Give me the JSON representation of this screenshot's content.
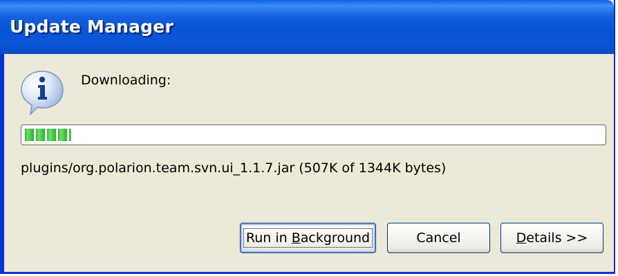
{
  "window": {
    "title": "Update Manager"
  },
  "message": {
    "icon": "info-icon",
    "text": "Downloading:"
  },
  "progress": {
    "fraction": 0.08,
    "file": "plugins/org.polarion.team.svn.ui_1.1.7.jar (507K of 1344K bytes)"
  },
  "buttons": {
    "run_in_background": {
      "prefix": "Run in ",
      "mnemonic": "B",
      "suffix": "ackground"
    },
    "cancel": {
      "label": "Cancel"
    },
    "details": {
      "mnemonic": "D",
      "suffix": "etails >>"
    }
  },
  "colors": {
    "titlebar": "#0655d4",
    "frame": "#0831d9",
    "dialog_bg": "#ece9d8",
    "progress_fill": "#2fb62f"
  }
}
